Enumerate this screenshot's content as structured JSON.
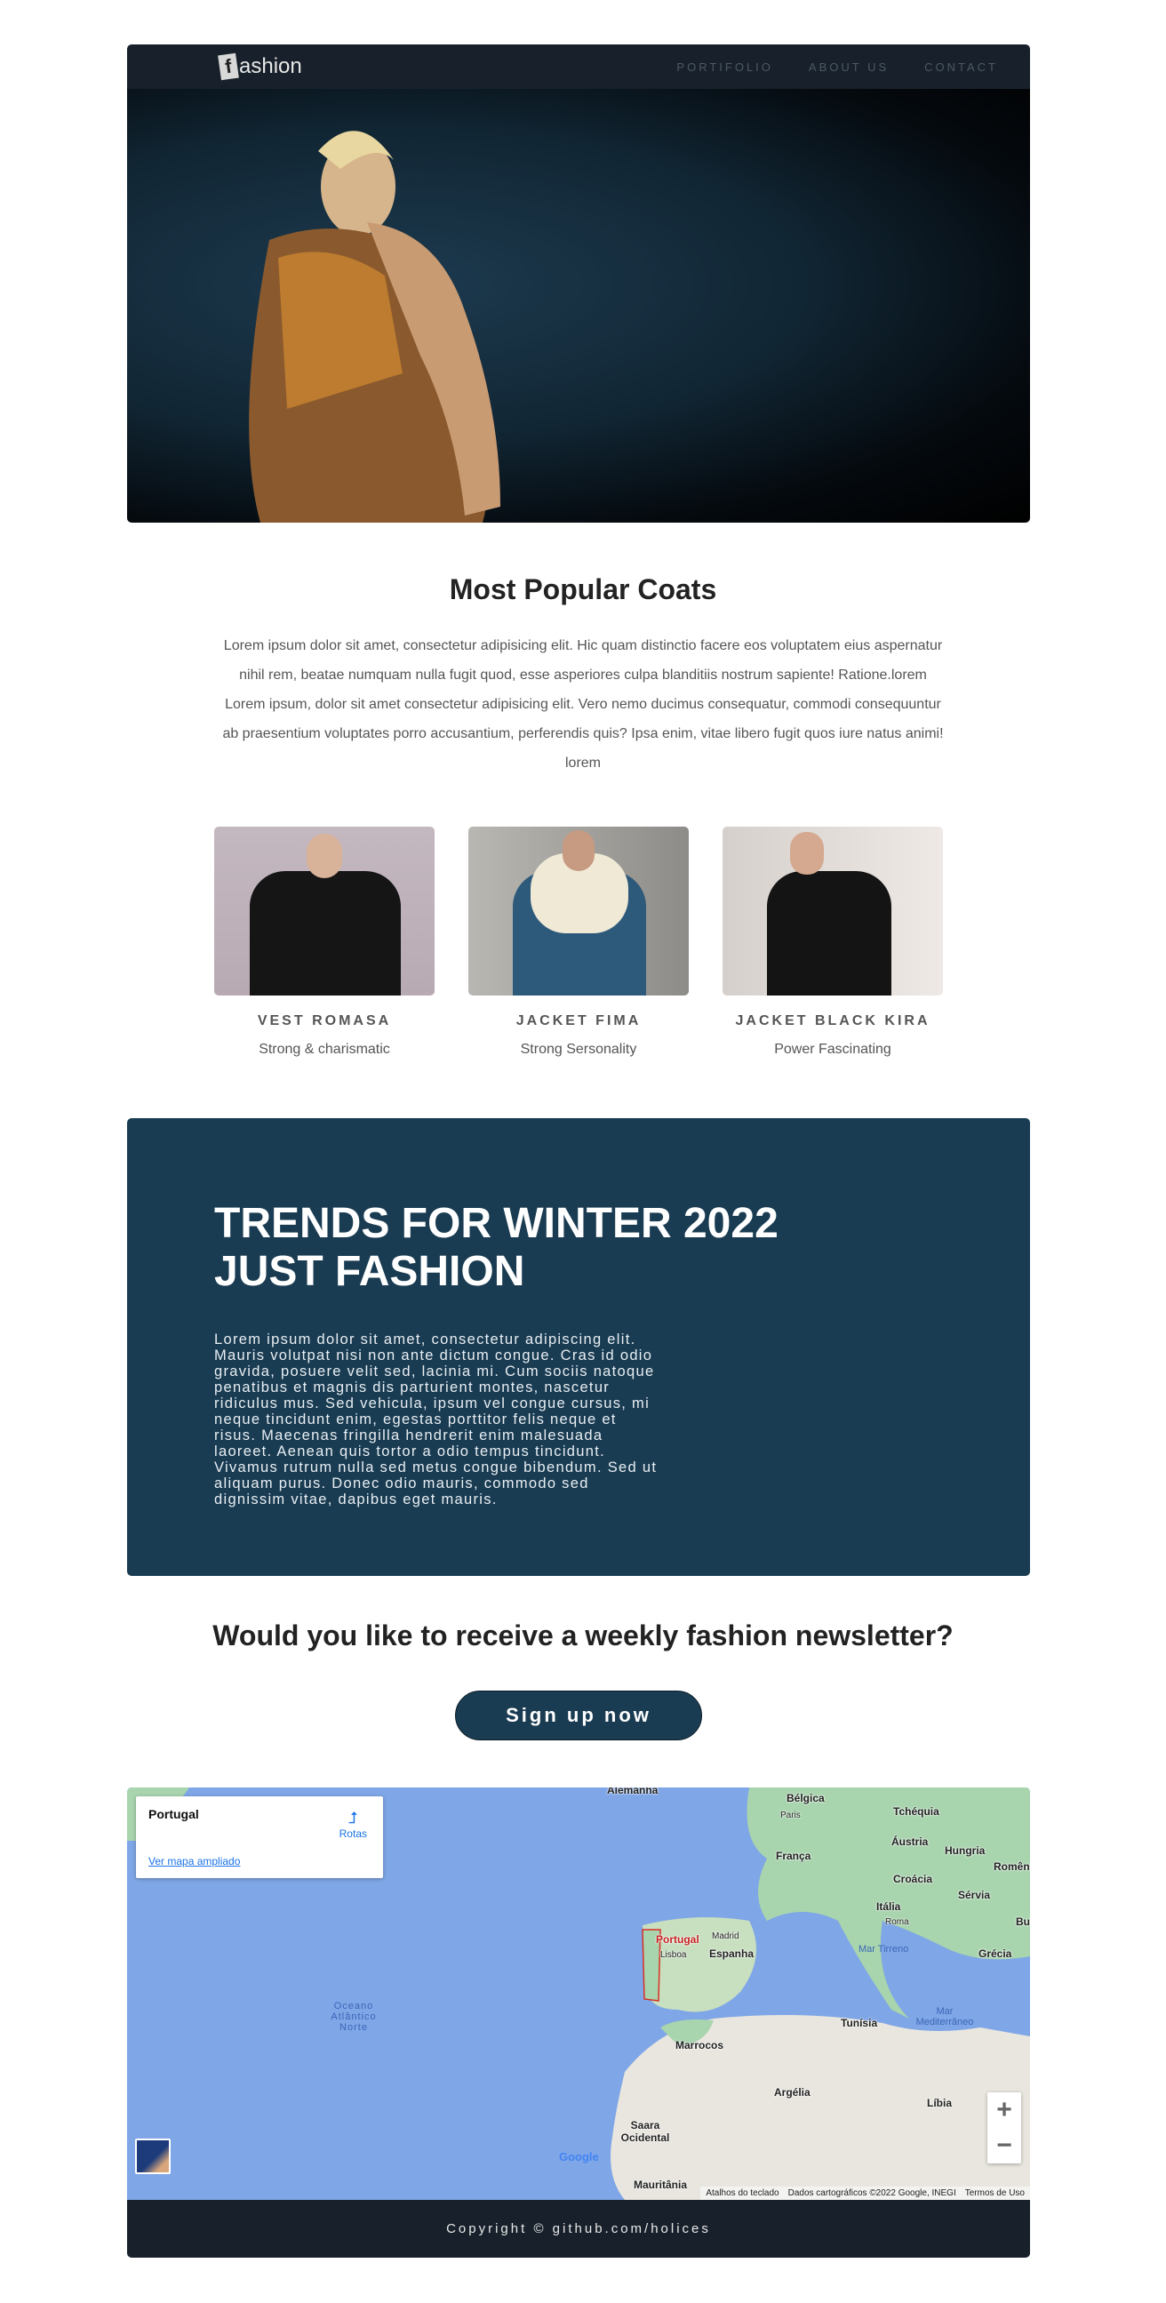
{
  "nav": {
    "logo_letter": "f",
    "logo_rest": "ashion",
    "items": [
      "PORTIFOLIO",
      "ABOUT US",
      "CONTACT"
    ]
  },
  "popular": {
    "title": "Most Popular Coats",
    "text": "Lorem ipsum dolor sit amet, consectetur adipisicing elit. Hic quam distinctio facere eos voluptatem eius aspernatur nihil rem, beatae numquam nulla fugit quod, esse asperiores culpa blanditiis nostrum sapiente! Ratione.lorem Lorem ipsum, dolor sit amet consectetur adipisicing elit. Vero nemo ducimus consequatur, commodi consequuntur ab praesentium voluptates porro accusantium, perferendis quis? Ipsa enim, vitae libero fugit quos iure natus animi! lorem"
  },
  "products": [
    {
      "name": "VEST ROMASA",
      "tagline": "Strong & charismatic"
    },
    {
      "name": "JACKET FIMA",
      "tagline": "Strong Sersonality"
    },
    {
      "name": "JACKET BLACK KIRA",
      "tagline": "Power Fascinating"
    }
  ],
  "trends": {
    "line1": "TRENDS FOR WINTER 2022",
    "line2": "JUST FASHION",
    "text": "Lorem ipsum dolor sit amet, consectetur adipiscing elit. Mauris volutpat nisi non ante dictum congue. Cras id odio gravida, posuere velit sed, lacinia mi. Cum sociis natoque penatibus et magnis dis parturient montes, nascetur ridiculus mus. Sed vehicula, ipsum vel congue cursus, mi neque tincidunt enim, egestas porttitor felis neque et risus. Maecenas fringilla hendrerit enim malesuada laoreet. Aenean quis tortor a odio tempus tincidunt. Vivamus rutrum nulla sed metus congue bibendum. Sed ut aliquam purus. Donec odio mauris, commodo sed dignissim vitae, dapibus eget mauris."
  },
  "newsletter": {
    "question": "Would you like to receive a weekly fashion newsletter?",
    "button": "Sign up now"
  },
  "map": {
    "place": "Portugal",
    "directions": "Rotas",
    "larger_map": "Ver mapa ampliado",
    "labels": [
      "Alemanha",
      "Bélgica",
      "Paris",
      "Tchéquia",
      "França",
      "Áustria",
      "Hungria",
      "Romênia",
      "Croácia",
      "Sérvia",
      "Itália",
      "Roma",
      "Bulgária",
      "Portugal",
      "Madrid",
      "Lisboa",
      "Espanha",
      "Grécia",
      "Tunísia",
      "Marrocos",
      "Argélia",
      "Líbia",
      "Saara Ocidental",
      "Mauritânia"
    ],
    "seas": [
      "Mar Tirreno",
      "Mar Mediterrâneo",
      "Oceano Atlântico Norte"
    ],
    "attribution": [
      "Atalhos do teclado",
      "Dados cartográficos ©2022 Google, INEGI",
      "Termos de Uso"
    ],
    "google": "Google",
    "colors": {
      "water": "#7fa6e6",
      "land": "#a8d4ae",
      "desert": "#e9e6df"
    }
  },
  "footer": {
    "copyright": "Copyright © github.com/holices"
  }
}
